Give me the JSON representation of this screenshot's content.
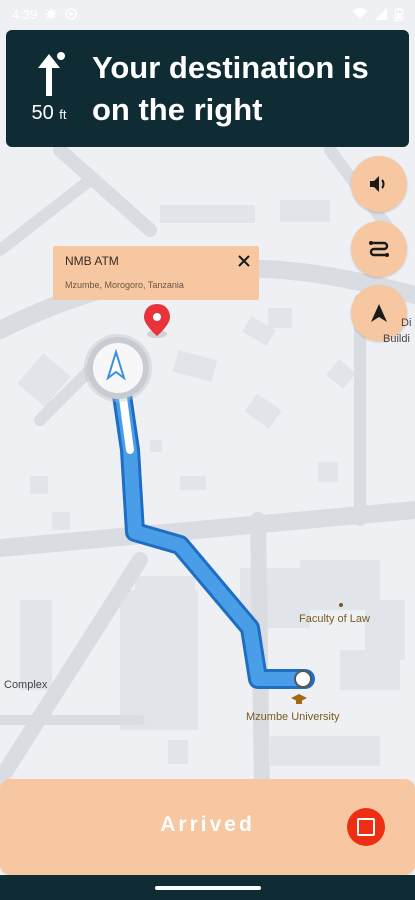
{
  "status_bar": {
    "time": "4:39",
    "icons": [
      "gear-icon",
      "settings-icon",
      "wifi-icon",
      "cellular-signal-icon",
      "battery-icon"
    ]
  },
  "navigation": {
    "distance_value": "50",
    "distance_unit": "ft",
    "instruction": "Your destination is on the right",
    "maneuver_icon": "straight-arrow-icon"
  },
  "controls": {
    "mute_icon": "speaker-icon",
    "overview_icon": "route-overview-icon",
    "recenter_icon": "navigation-arrow-icon"
  },
  "place_card": {
    "name": "NMB ATM",
    "address": "Mzumbe, Morogoro, Tanzania"
  },
  "map_labels": {
    "faculty": "Faculty of Law",
    "university": "Mzumbe University",
    "complex": "Complex",
    "partial_di": "Di",
    "partial_building": "Buildi"
  },
  "bottom": {
    "arrived_label": "Arrived"
  },
  "colors": {
    "banner": "#0f2b33",
    "accent": "#f6c7a0",
    "route": "#3a8fe0",
    "stop": "#ef2d12"
  }
}
